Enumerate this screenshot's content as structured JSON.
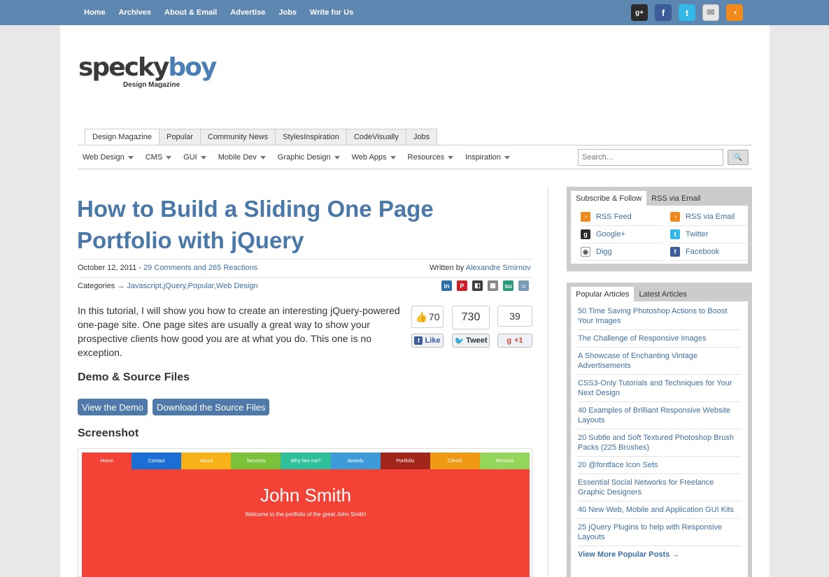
{
  "top_nav": [
    "Home",
    "Archives",
    "About & Email",
    "Advertise",
    "Jobs",
    "Write for Us"
  ],
  "top_social": [
    "google-plus-icon",
    "facebook-icon",
    "twitter-icon",
    "email-icon",
    "rss-icon"
  ],
  "logo": {
    "name_part1": "specky",
    "name_part2": "boy",
    "subtitle": "Design Magazine"
  },
  "site_tabs": [
    "Design Magazine",
    "Popular",
    "Community News",
    "StylesInspiration",
    "CodeVisually",
    "Jobs"
  ],
  "category_nav": [
    "Web Design",
    "CMS",
    "GUI",
    "Mobile Dev",
    "Graphic Design",
    "Web Apps",
    "Resources",
    "Inspiration"
  ],
  "search": {
    "placeholder": "Search..."
  },
  "article": {
    "title": "How to Build a Sliding One Page Portfolio with jQuery",
    "date": "October 12, 2011 - ",
    "comments_link": "29 Comments and 265 Reactions",
    "written_by": "Written by ",
    "author": "Alexandre Smirnov",
    "categories_label": "Categories → ",
    "categories_links": "Javascript,jQuery,Popular,Web Design",
    "intro": "In this tutorial, I will show you how to create an interesting jQuery-powered one-page site. One page sites are usually a great way to show your prospective clients how good you are at what you do. This one is no exception.",
    "demo_heading": "Demo & Source Files",
    "view_demo": "View the Demo",
    "download_source": "Download the Source Files",
    "screenshot_heading": "Screenshot"
  },
  "share_counts": {
    "like_count": "70",
    "like_label": "Like",
    "tweet_count": "730",
    "tweet_label": "Tweet",
    "plus_count": "39",
    "plus_label": "+1"
  },
  "screenshot": {
    "nav": [
      {
        "label": "Home",
        "color": "#f44336"
      },
      {
        "label": "Contact",
        "color": "#1a6fd6"
      },
      {
        "label": "About",
        "color": "#f7b21a"
      },
      {
        "label": "Services",
        "color": "#7cc13a"
      },
      {
        "label": "Why hire me?",
        "color": "#2fbf9a"
      },
      {
        "label": "Awards",
        "color": "#3d9bd9"
      },
      {
        "label": "Portfolio",
        "color": "#a3261a"
      },
      {
        "label": "Clients",
        "color": "#ef9a12"
      },
      {
        "label": "Resume",
        "color": "#93d65a"
      }
    ],
    "name": "John Smith",
    "tagline": "Welcome to the portfolio of the great John Smith!"
  },
  "sidebar": {
    "follow_tabs": [
      "Subscribe & Follow",
      "RSS via Email"
    ],
    "follow_items": [
      {
        "label": "RSS Feed",
        "icon": "rss-icon"
      },
      {
        "label": "RSS via Email",
        "icon": "rss-icon"
      },
      {
        "label": "Google+",
        "icon": "google-plus-icon"
      },
      {
        "label": "Twitter",
        "icon": "twitter-icon"
      },
      {
        "label": "Digg",
        "icon": "digg-icon"
      },
      {
        "label": "Facebook",
        "icon": "facebook-icon"
      }
    ],
    "articles_tabs": [
      "Popular Articles",
      "Latest Articles"
    ],
    "popular_articles": [
      "50 Time Saving Photoshop Actions to Boost Your Images",
      "The Challenge of Responsive Images",
      "A Showcase of Enchanting Vintage Advertisements",
      "CSS3-Only Tutorials and Techniques for Your Next Design",
      "40 Examples of Brilliant Responsive Website Layouts",
      "20 Subtle and Soft Textured Photoshop Brush Packs (225 Brushes)",
      "20 @fontface Icon Sets",
      "Essential Social Networks for Freelance Graphic Designers",
      "40 New Web, Mobile and Application GUI Kits",
      "25 jQuery Plugins to help with Responsive Layouts"
    ],
    "view_more": "View More Popular Posts →"
  }
}
